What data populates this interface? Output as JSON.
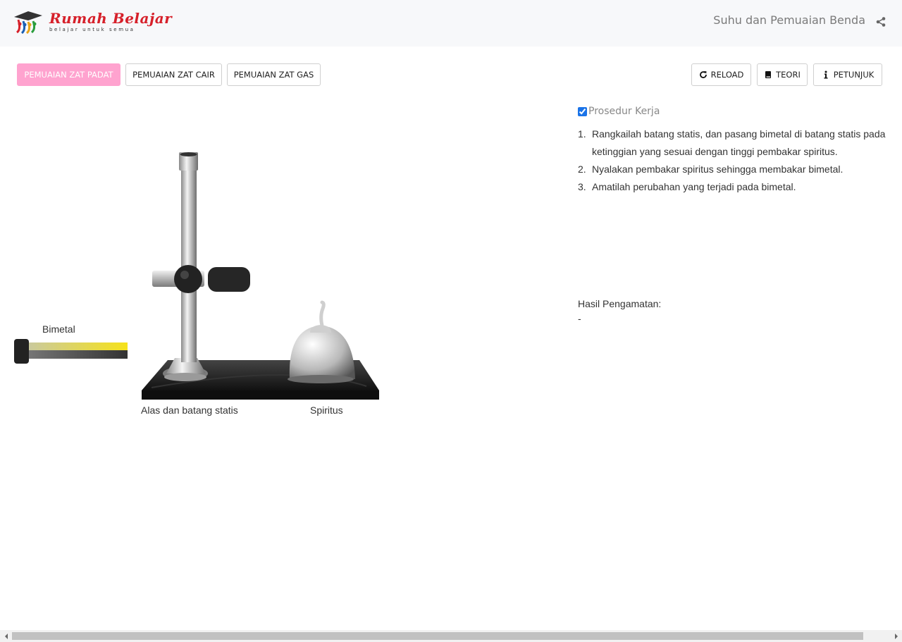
{
  "header": {
    "logo_title": "Rumah Belajar",
    "logo_tagline": "belajar untuk semua",
    "page_title": "Suhu dan Pemuaian Benda"
  },
  "tabs": [
    {
      "label": "PEMUAIAN ZAT PADAT",
      "active": true
    },
    {
      "label": "PEMUAIAN ZAT CAIR",
      "active": false
    },
    {
      "label": "PEMUAIAN ZAT GAS",
      "active": false
    }
  ],
  "actions": {
    "reload": "RELOAD",
    "teori": "TEORI",
    "petunjuk": "PETUNJUK"
  },
  "stage": {
    "bimetal_label": "Bimetal",
    "stand_label": "Alas dan batang statis",
    "spiritus_label": "Spiritus"
  },
  "procedure": {
    "title": "Prosedur Kerja",
    "checked": true,
    "steps": [
      {
        "num": "1.",
        "text": "Rangkailah batang statis, dan pasang bimetal di batang statis pada ketinggian yang sesuai dengan tinggi pembakar spiritus."
      },
      {
        "num": "2.",
        "text": "Nyalakan pembakar spiritus sehingga membakar bimetal."
      },
      {
        "num": "3.",
        "text": "Amatilah perubahan yang terjadi pada bimetal."
      }
    ]
  },
  "result": {
    "label": "Hasil Pengamatan:",
    "value": "-"
  },
  "colors": {
    "accent_pink": "#ffa3cf",
    "brand_red": "#d6202a",
    "bimetal_yellow": "#f6e21a"
  }
}
